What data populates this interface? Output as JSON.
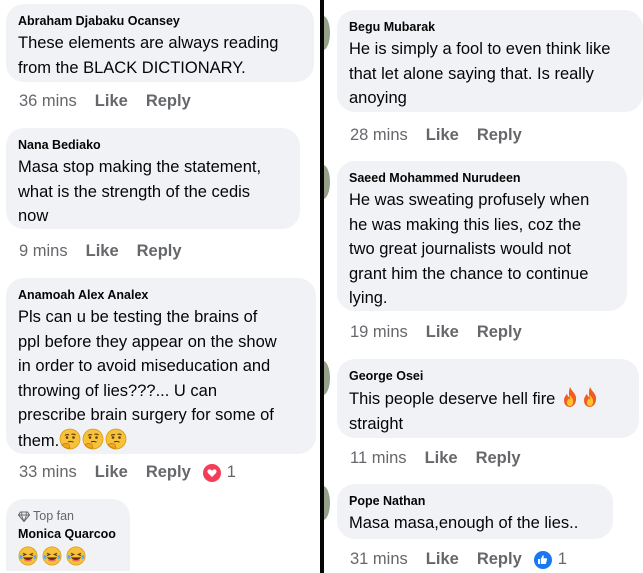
{
  "left": {
    "comments": [
      {
        "author": "Abraham Djabaku Ocansey",
        "lines": [
          "These elements are always reading",
          "from the BLACK DICTIONARY."
        ],
        "time": "36 mins",
        "like": "Like",
        "reply": "Reply"
      },
      {
        "author": "Nana Bediako",
        "lines": [
          "Masa stop making the statement,",
          "what is the strength of the cedis",
          "now"
        ],
        "time": "9 mins",
        "like": "Like",
        "reply": "Reply"
      },
      {
        "author": "Anamoah Alex Analex",
        "lines": [
          "Pls can u be testing the brains of",
          "ppl before they appear on the show",
          "in order to avoid miseducation and",
          "throwing of lies???... U can",
          "prescribe brain surgery for some of",
          "them."
        ],
        "time": "33 mins",
        "like": "Like",
        "reply": "Reply",
        "reaction_count": "1"
      },
      {
        "badge": "Top fan",
        "author": "Monica Quarcoo"
      }
    ]
  },
  "right": {
    "comments": [
      {
        "author": "Begu Mubarak",
        "lines": [
          "He is simply a fool to even think like",
          "that let alone saying that. Is really",
          "anoying"
        ],
        "time": "28 mins",
        "like": "Like",
        "reply": "Reply"
      },
      {
        "author": "Saeed Mohammed Nurudeen",
        "lines": [
          "He was sweating profusely when",
          "he was making this lies, coz the",
          "two great journalists would not",
          "grant him the chance to continue",
          "lying."
        ],
        "time": "19 mins",
        "like": "Like",
        "reply": "Reply"
      },
      {
        "author": "George Osei",
        "lines": [
          "This people deserve hell fire",
          "straight"
        ],
        "time": "11 mins",
        "like": "Like",
        "reply": "Reply"
      },
      {
        "author": "Pope Nathan",
        "lines": [
          "Masa masa,enough of the lies.."
        ],
        "time": "31 mins",
        "like": "Like",
        "reply": "Reply",
        "reaction_count": "1"
      }
    ]
  },
  "icons": {
    "thinking_emoji": "thinking-face-icon",
    "laughing_emoji": "laughing-face-icon",
    "fire_emoji": "fire-icon",
    "heart_reaction": "heart-reaction-icon",
    "like_reaction": "thumbs-up-reaction-icon",
    "top_fan_badge": "diamond-icon"
  },
  "colors": {
    "bubble": "#f0f2f5",
    "meta_text": "#65676b",
    "heart": "#f33e58",
    "like_blue": "#1877f2",
    "divider": "#050505"
  }
}
